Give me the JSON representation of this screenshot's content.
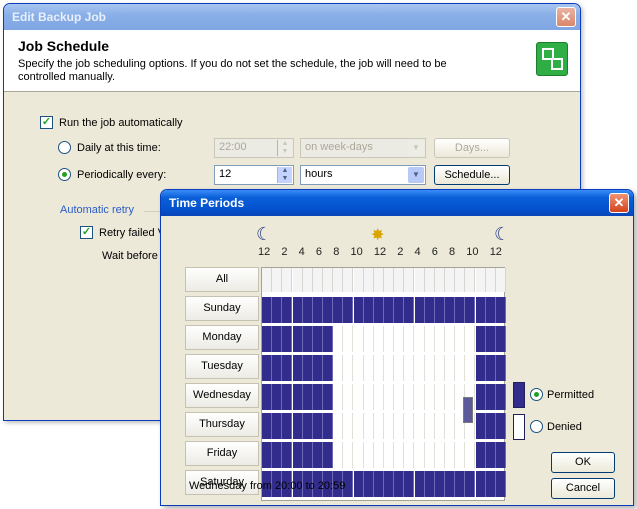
{
  "back_window": {
    "title": "Edit Backup Job",
    "close_label": "✕",
    "header_title": "Job Schedule",
    "header_desc": "Specify the job scheduling options. If you do not set the schedule, the job will need to be controlled manually.",
    "run_auto_label": "Run the job automatically",
    "run_auto_checked": true,
    "daily_label": "Daily at this time:",
    "daily_time": "22:00",
    "daily_days_value": "on week-days",
    "days_button": "Days...",
    "periodic_label": "Periodically every:",
    "periodic_value": "12",
    "periodic_unit": "hours",
    "schedule_button": "Schedule...",
    "auto_retry_label": "Automatic retry",
    "retry_label": "Retry failed V",
    "wait_label": "Wait before r"
  },
  "front_window": {
    "title": "Time Periods",
    "close_label": "✕",
    "hour_labels": [
      "12",
      "2",
      "4",
      "6",
      "8",
      "10",
      "12",
      "2",
      "4",
      "6",
      "8",
      "10",
      "12"
    ],
    "days": [
      "All",
      "Sunday",
      "Monday",
      "Tuesday",
      "Wednesday",
      "Thursday",
      "Friday",
      "Saturday"
    ],
    "permitted_label": "Permitted",
    "denied_label": "Denied",
    "selected_mode": "Permitted",
    "ok_button": "OK",
    "cancel_button": "Cancel",
    "status": "Wednesday from 20:00 to 20:59",
    "schedule_grid": {
      "permitted_color": "#322d8c",
      "denied_color": "#ffffff",
      "weekday_permitted_hours": [
        0,
        1,
        2,
        3,
        4,
        5,
        6,
        21,
        22,
        23
      ],
      "weekend_all_permitted": true,
      "selected_cell": {
        "day": "Wednesday",
        "hour": 20
      }
    }
  }
}
